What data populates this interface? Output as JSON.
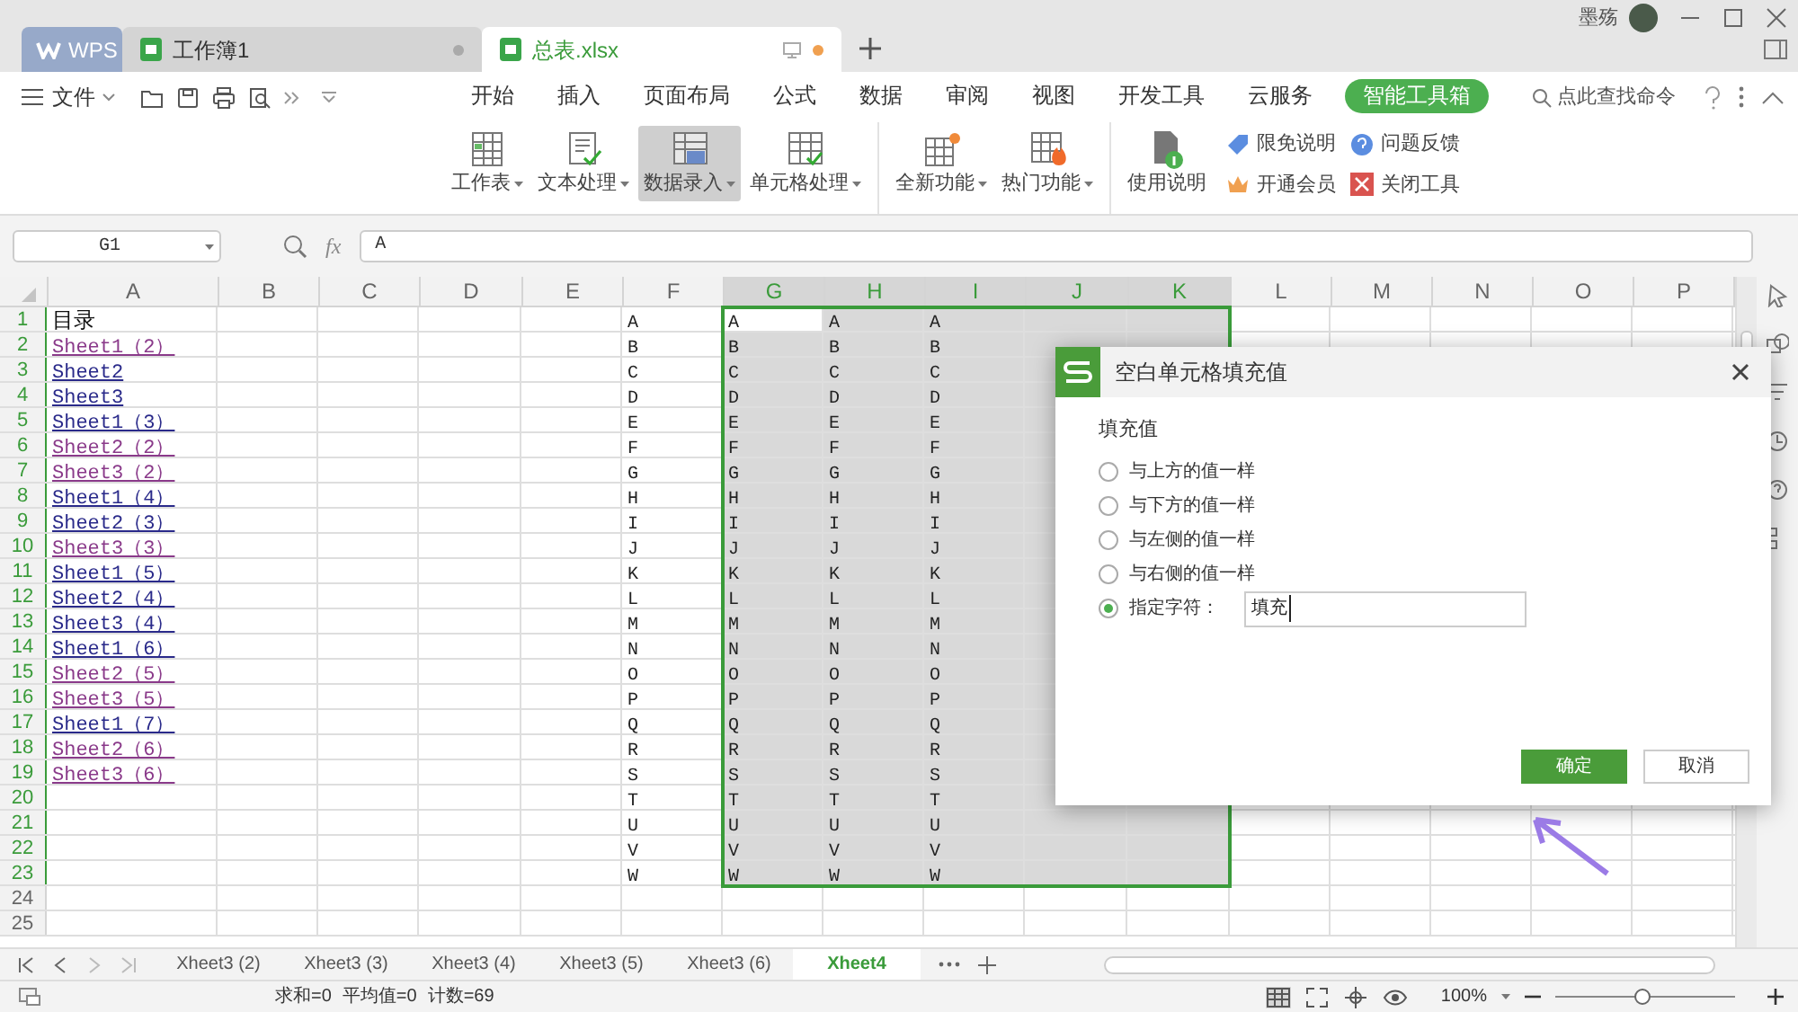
{
  "title_bar": {
    "tabs": [
      {
        "label": "WPS",
        "kind": "logo",
        "selected": false
      },
      {
        "label": "工作簿1",
        "kind": "doc",
        "selected": false
      },
      {
        "label": "总表.xlsx",
        "kind": "doc",
        "selected": true
      }
    ],
    "user": "墨殇"
  },
  "menu": {
    "file": "文件",
    "tabs": [
      {
        "label": "开始",
        "selected": false
      },
      {
        "label": "插入",
        "selected": false
      },
      {
        "label": "页面布局",
        "selected": false
      },
      {
        "label": "公式",
        "selected": false
      },
      {
        "label": "数据",
        "selected": false
      },
      {
        "label": "审阅",
        "selected": false
      },
      {
        "label": "视图",
        "selected": false
      },
      {
        "label": "开发工具",
        "selected": false
      },
      {
        "label": "云服务",
        "selected": false
      },
      {
        "label": "智能工具箱",
        "selected": true
      }
    ],
    "search": "点此查找命令"
  },
  "ribbon": {
    "groups": [
      [
        {
          "label": "工作表",
          "kind": "sheet",
          "dropdown": true,
          "pressed": false
        },
        {
          "label": "文本处理",
          "kind": "text",
          "dropdown": true,
          "pressed": false
        },
        {
          "label": "数据录入",
          "kind": "entry",
          "dropdown": true,
          "pressed": true
        },
        {
          "label": "单元格处理",
          "kind": "cell",
          "dropdown": true,
          "pressed": false
        }
      ],
      [
        {
          "label": "全新功能",
          "kind": "new",
          "dropdown": true,
          "pressed": false
        },
        {
          "label": "热门功能",
          "kind": "hot",
          "dropdown": true,
          "pressed": false
        }
      ],
      [
        {
          "label": "使用说明",
          "kind": "doc",
          "dropdown": false,
          "pressed": false
        }
      ]
    ],
    "small": [
      {
        "label": "限免说明",
        "kind": "tag"
      },
      {
        "label": "问题反馈",
        "kind": "help"
      },
      {
        "label": "开通会员",
        "kind": "crown"
      },
      {
        "label": "关闭工具",
        "kind": "close"
      }
    ]
  },
  "formula_bar": {
    "name_box": "G1",
    "fx_label": "fx",
    "formula": "A"
  },
  "sheet": {
    "columns": [
      {
        "label": "A",
        "selected": false
      },
      {
        "label": "B",
        "selected": false
      },
      {
        "label": "C",
        "selected": false
      },
      {
        "label": "D",
        "selected": false
      },
      {
        "label": "E",
        "selected": false
      },
      {
        "label": "F",
        "selected": false
      },
      {
        "label": "G",
        "selected": true
      },
      {
        "label": "H",
        "selected": true
      },
      {
        "label": "I",
        "selected": true
      },
      {
        "label": "J",
        "selected": true
      },
      {
        "label": "K",
        "selected": true
      },
      {
        "label": "L",
        "selected": false
      },
      {
        "label": "M",
        "selected": false
      },
      {
        "label": "N",
        "selected": false
      },
      {
        "label": "O",
        "selected": false
      },
      {
        "label": "P",
        "selected": false
      }
    ],
    "rows": [
      {
        "label": "1",
        "selected": true,
        "cells": {
          "A": {
            "text": "目录",
            "kind": "text"
          },
          "F": "A",
          "G": "A",
          "H": "A",
          "I": "A"
        }
      },
      {
        "label": "2",
        "selected": true,
        "cells": {
          "A": {
            "text": "Sheet1（2）",
            "kind": "link",
            "visited": true
          },
          "F": "B",
          "G": "B",
          "H": "B",
          "I": "B"
        }
      },
      {
        "label": "3",
        "selected": true,
        "cells": {
          "A": {
            "text": "Sheet2",
            "kind": "link",
            "visited": false
          },
          "F": "C",
          "G": "C",
          "H": "C",
          "I": "C"
        }
      },
      {
        "label": "4",
        "selected": true,
        "cells": {
          "A": {
            "text": "Sheet3",
            "kind": "link",
            "visited": false
          },
          "F": "D",
          "G": "D",
          "H": "D",
          "I": "D"
        }
      },
      {
        "label": "5",
        "selected": true,
        "cells": {
          "A": {
            "text": "Sheet1（3）",
            "kind": "link",
            "visited": false
          },
          "F": "E",
          "G": "E",
          "H": "E",
          "I": "E"
        }
      },
      {
        "label": "6",
        "selected": true,
        "cells": {
          "A": {
            "text": "Sheet2（2）",
            "kind": "link",
            "visited": true
          },
          "F": "F",
          "G": "F",
          "H": "F",
          "I": "F"
        }
      },
      {
        "label": "7",
        "selected": true,
        "cells": {
          "A": {
            "text": "Sheet3（2）",
            "kind": "link",
            "visited": true
          },
          "F": "G",
          "G": "G",
          "H": "G",
          "I": "G"
        }
      },
      {
        "label": "8",
        "selected": true,
        "cells": {
          "A": {
            "text": "Sheet1（4）",
            "kind": "link",
            "visited": false
          },
          "F": "H",
          "G": "H",
          "H": "H",
          "I": "H"
        }
      },
      {
        "label": "9",
        "selected": true,
        "cells": {
          "A": {
            "text": "Sheet2（3）",
            "kind": "link",
            "visited": false
          },
          "F": "I",
          "G": "I",
          "H": "I",
          "I": "I"
        }
      },
      {
        "label": "10",
        "selected": true,
        "cells": {
          "A": {
            "text": "Sheet3（3）",
            "kind": "link",
            "visited": true
          },
          "F": "J",
          "G": "J",
          "H": "J",
          "I": "J"
        }
      },
      {
        "label": "11",
        "selected": true,
        "cells": {
          "A": {
            "text": "Sheet1（5）",
            "kind": "link",
            "visited": false
          },
          "F": "K",
          "G": "K",
          "H": "K",
          "I": "K"
        }
      },
      {
        "label": "12",
        "selected": true,
        "cells": {
          "A": {
            "text": "Sheet2（4）",
            "kind": "link",
            "visited": false
          },
          "F": "L",
          "G": "L",
          "H": "L",
          "I": "L"
        }
      },
      {
        "label": "13",
        "selected": true,
        "cells": {
          "A": {
            "text": "Sheet3（4）",
            "kind": "link",
            "visited": false
          },
          "F": "M",
          "G": "M",
          "H": "M",
          "I": "M"
        }
      },
      {
        "label": "14",
        "selected": true,
        "cells": {
          "A": {
            "text": "Sheet1（6）",
            "kind": "link",
            "visited": false
          },
          "F": "N",
          "G": "N",
          "H": "N",
          "I": "N"
        }
      },
      {
        "label": "15",
        "selected": true,
        "cells": {
          "A": {
            "text": "Sheet2（5）",
            "kind": "link",
            "visited": true
          },
          "F": "O",
          "G": "O",
          "H": "O",
          "I": "O"
        }
      },
      {
        "label": "16",
        "selected": true,
        "cells": {
          "A": {
            "text": "Sheet3（5）",
            "kind": "link",
            "visited": true
          },
          "F": "P",
          "G": "P",
          "H": "P",
          "I": "P"
        }
      },
      {
        "label": "17",
        "selected": true,
        "cells": {
          "A": {
            "text": "Sheet1（7）",
            "kind": "link",
            "visited": false
          },
          "F": "Q",
          "G": "Q",
          "H": "Q",
          "I": "Q"
        }
      },
      {
        "label": "18",
        "selected": true,
        "cells": {
          "A": {
            "text": "Sheet2（6）",
            "kind": "link",
            "visited": true
          },
          "F": "R",
          "G": "R",
          "H": "R",
          "I": "R"
        }
      },
      {
        "label": "19",
        "selected": true,
        "cells": {
          "A": {
            "text": "Sheet3（6）",
            "kind": "link",
            "visited": true
          },
          "F": "S",
          "G": "S",
          "H": "S",
          "I": "S"
        }
      },
      {
        "label": "20",
        "selected": true,
        "cells": {
          "F": "T",
          "G": "T",
          "H": "T",
          "I": "T"
        }
      },
      {
        "label": "21",
        "selected": true,
        "cells": {
          "F": "U",
          "G": "U",
          "H": "U",
          "I": "U"
        }
      },
      {
        "label": "22",
        "selected": true,
        "cells": {
          "F": "V",
          "G": "V",
          "H": "V",
          "I": "V"
        }
      },
      {
        "label": "23",
        "selected": true,
        "cells": {
          "F": "W",
          "G": "W",
          "H": "W",
          "I": "W"
        }
      },
      {
        "label": "24",
        "selected": false,
        "cells": {}
      },
      {
        "label": "25",
        "selected": false,
        "cells": {}
      }
    ]
  },
  "sheet_tabs": [
    {
      "label": "Xheet3 (2)",
      "selected": false
    },
    {
      "label": "Xheet3 (3)",
      "selected": false
    },
    {
      "label": "Xheet3 (4)",
      "selected": false
    },
    {
      "label": "Xheet3 (5)",
      "selected": false
    },
    {
      "label": "Xheet3 (6)",
      "selected": false
    },
    {
      "label": "Xheet4",
      "selected": true
    }
  ],
  "status_bar": {
    "stats": [
      "求和=0",
      "平均值=0",
      "计数=69"
    ],
    "zoom": "100%",
    "zoom_slider": {
      "level": 0.48
    }
  },
  "dialog": {
    "title": "空白单元格填充值",
    "group_label": "填充值",
    "options": [
      {
        "label": "与上方的值一样",
        "selected": false
      },
      {
        "label": "与下方的值一样",
        "selected": false
      },
      {
        "label": "与左侧的值一样",
        "selected": false
      },
      {
        "label": "与右侧的值一样",
        "selected": false
      },
      {
        "label": "指定字符：",
        "selected": true
      }
    ],
    "input_value": "填充",
    "buttons": [
      {
        "label": "确定",
        "kind": "primary"
      },
      {
        "label": "取消",
        "kind": "secondary"
      }
    ]
  }
}
